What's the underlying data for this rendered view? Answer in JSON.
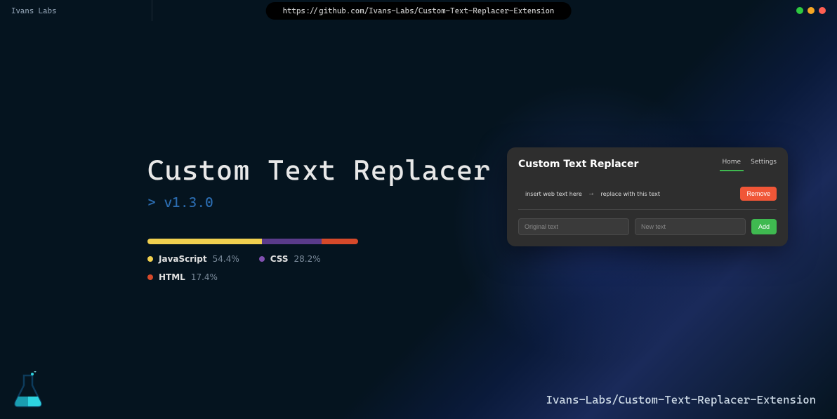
{
  "topbar": {
    "brand": "Ivans Labs",
    "url": "https://github.com/Ivans-Labs/Custom-Text-Replacer-Extension"
  },
  "project": {
    "title": "Custom Text Replacer",
    "version_prefix": "> ",
    "version": "v1.3.0"
  },
  "languages": [
    {
      "name": "JavaScript",
      "percent": "54.4%",
      "color": "#f1d04f"
    },
    {
      "name": "CSS",
      "percent": "28.2%",
      "color": "#5a3b8a"
    },
    {
      "name": "HTML",
      "percent": "17.4%",
      "color": "#d6492a"
    }
  ],
  "popup": {
    "title": "Custom Text Replacer",
    "tabs": {
      "home": "Home",
      "settings": "Settings"
    },
    "sample": {
      "original": "insert web text here",
      "arrow": "→",
      "replacement": "replace with this text"
    },
    "buttons": {
      "remove": "Remove",
      "add": "Add"
    },
    "placeholders": {
      "original": "Original text",
      "newtext": "New text"
    }
  },
  "footer": {
    "repo": "Ivans-Labs/Custom-Text-Replacer-Extension"
  }
}
